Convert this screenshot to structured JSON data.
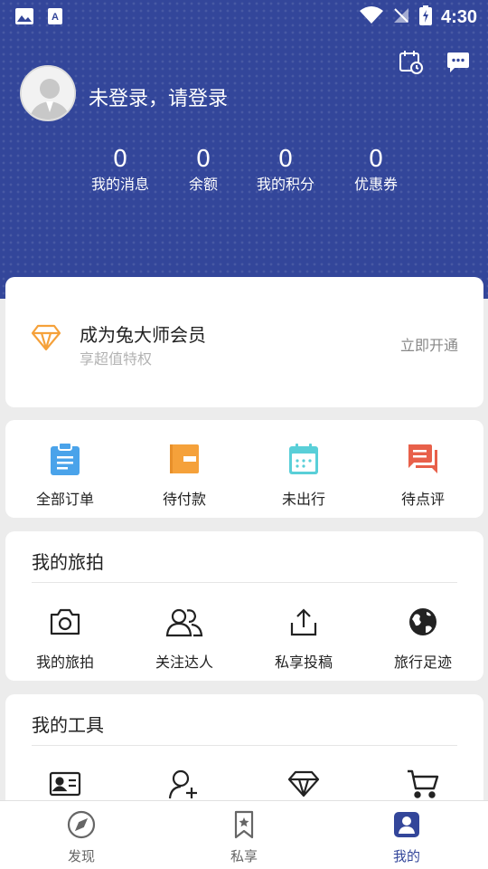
{
  "status_bar": {
    "time": "4:30"
  },
  "header": {
    "login_text": "未登录，请登录",
    "stats": [
      {
        "value": "0",
        "label": "我的消息"
      },
      {
        "value": "0",
        "label": "余额"
      },
      {
        "value": "0",
        "label": "我的积分"
      },
      {
        "value": "0",
        "label": "优惠券"
      }
    ]
  },
  "vip": {
    "title": "成为兔大师会员",
    "subtitle": "享超值特权",
    "action": "立即开通"
  },
  "orders": [
    {
      "label": "全部订单",
      "icon": "clipboard-icon",
      "color": "#4aa3ea"
    },
    {
      "label": "待付款",
      "icon": "wallet-icon",
      "color": "#f5a13a"
    },
    {
      "label": "未出行",
      "icon": "calendar-icon",
      "color": "#59cfd8"
    },
    {
      "label": "待点评",
      "icon": "comment-icon",
      "color": "#e8604a"
    }
  ],
  "travel_photo": {
    "title": "我的旅拍",
    "items": [
      {
        "label": "我的旅拍",
        "icon": "camera-icon"
      },
      {
        "label": "关注达人",
        "icon": "users-icon"
      },
      {
        "label": "私享投稿",
        "icon": "upload-icon"
      },
      {
        "label": "旅行足迹",
        "icon": "globe-icon"
      }
    ]
  },
  "tools": {
    "title": "我的工具",
    "items": [
      {
        "icon": "id-card-icon"
      },
      {
        "icon": "add-user-icon"
      },
      {
        "icon": "diamond-icon"
      },
      {
        "icon": "cart-icon"
      }
    ]
  },
  "bottom_nav": [
    {
      "label": "发现",
      "icon": "compass-icon"
    },
    {
      "label": "私享",
      "icon": "bookmark-icon"
    },
    {
      "label": "我的",
      "icon": "profile-icon",
      "active": true
    }
  ],
  "colors": {
    "primary": "#33469a",
    "vip_gold": "#f5a13a"
  }
}
